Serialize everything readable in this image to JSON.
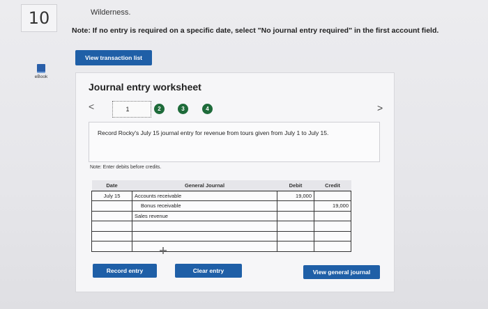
{
  "question": {
    "number": "10",
    "title": "Wilderness.",
    "note": "Note: If no entry is required on a specific date, select \"No journal entry required\" in the first account field."
  },
  "buttons": {
    "view_transaction_list": "View transaction list",
    "record_entry": "Record entry",
    "clear_entry": "Clear entry",
    "view_general_journal": "View general journal"
  },
  "sidebar": {
    "ebook_label": "eBook"
  },
  "worksheet": {
    "title": "Journal entry worksheet",
    "prev_glyph": "<",
    "next_glyph": ">",
    "steps": [
      "1",
      "2",
      "3",
      "4"
    ],
    "instruction": "Record Rocky's July 15 journal entry for revenue from tours given from July 1 to July 15.",
    "debit_note": "Note: Enter debits before credits."
  },
  "journal": {
    "headers": {
      "date": "Date",
      "account": "General Journal",
      "debit": "Debit",
      "credit": "Credit"
    },
    "rows": [
      {
        "date": "July 15",
        "account": "Accounts receivable",
        "debit": "19,000",
        "credit": ""
      },
      {
        "date": "",
        "account": "Bonus receivable",
        "debit": "",
        "credit": "19,000"
      },
      {
        "date": "",
        "account": "Sales revenue",
        "debit": "",
        "credit": ""
      },
      {
        "date": "",
        "account": "",
        "debit": "",
        "credit": ""
      },
      {
        "date": "",
        "account": "",
        "debit": "",
        "credit": ""
      },
      {
        "date": "",
        "account": "",
        "debit": "",
        "credit": ""
      }
    ],
    "add_row_icon": "plus-icon"
  },
  "colors": {
    "primary_button": "#1f5fa7",
    "step_dot": "#1e6b3a"
  }
}
